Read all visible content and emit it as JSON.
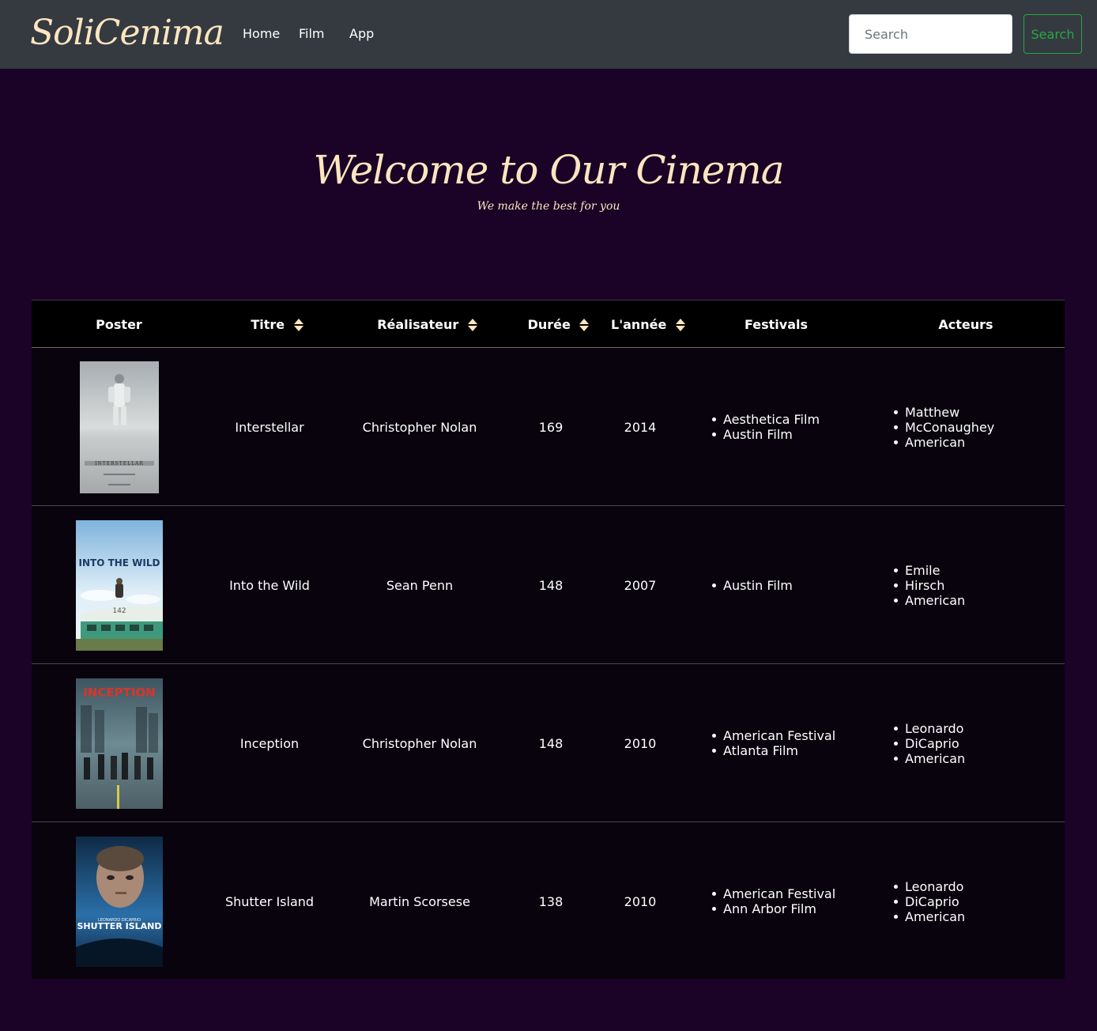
{
  "nav": {
    "brand": "SoliCenima",
    "links": [
      "Home",
      "Film",
      "App"
    ],
    "search_placeholder": "Search",
    "search_button": "Search"
  },
  "hero": {
    "title": "Welcome to Our Cinema",
    "subtitle": "We make the best for you"
  },
  "table": {
    "headers": [
      "Poster",
      "Titre",
      "Réalisateur",
      "Durée",
      "L'année",
      "Festivals",
      "Acteurs"
    ],
    "rows": [
      {
        "poster_text": "INTERSTELLAR",
        "titre": "Interstellar",
        "realisateur": "Christopher Nolan",
        "duree": "169",
        "annee": "2014",
        "festivals": [
          "Aesthetica Film",
          "Austin Film"
        ],
        "acteurs": [
          "Matthew",
          "McConaughey",
          "American"
        ]
      },
      {
        "poster_text": "INTO THE WILD",
        "poster_sub": "142",
        "titre": "Into the Wild",
        "realisateur": "Sean Penn",
        "duree": "148",
        "annee": "2007",
        "festivals": [
          "Austin Film"
        ],
        "acteurs": [
          "Emile",
          "Hirsch",
          "American"
        ]
      },
      {
        "poster_text": "INCEPTION",
        "titre": "Inception",
        "realisateur": "Christopher Nolan",
        "duree": "148",
        "annee": "2010",
        "festivals": [
          "American Festival",
          "Atlanta Film"
        ],
        "acteurs": [
          "Leonardo",
          "DiCaprio",
          "American"
        ]
      },
      {
        "poster_text": "SHUTTER ISLAND",
        "poster_sub": "LEONARDO DICAPRIO",
        "titre": "Shutter Island",
        "realisateur": "Martin Scorsese",
        "duree": "138",
        "annee": "2010",
        "festivals": [
          "American Festival",
          "Ann Arbor Film"
        ],
        "acteurs": [
          "Leonardo",
          "DiCaprio",
          "American"
        ]
      }
    ]
  },
  "colors": {
    "page_bg": "#1a0326",
    "navbar_bg": "#343a40",
    "accent_cream": "#fde5c0",
    "search_button_green": "#28a745"
  }
}
